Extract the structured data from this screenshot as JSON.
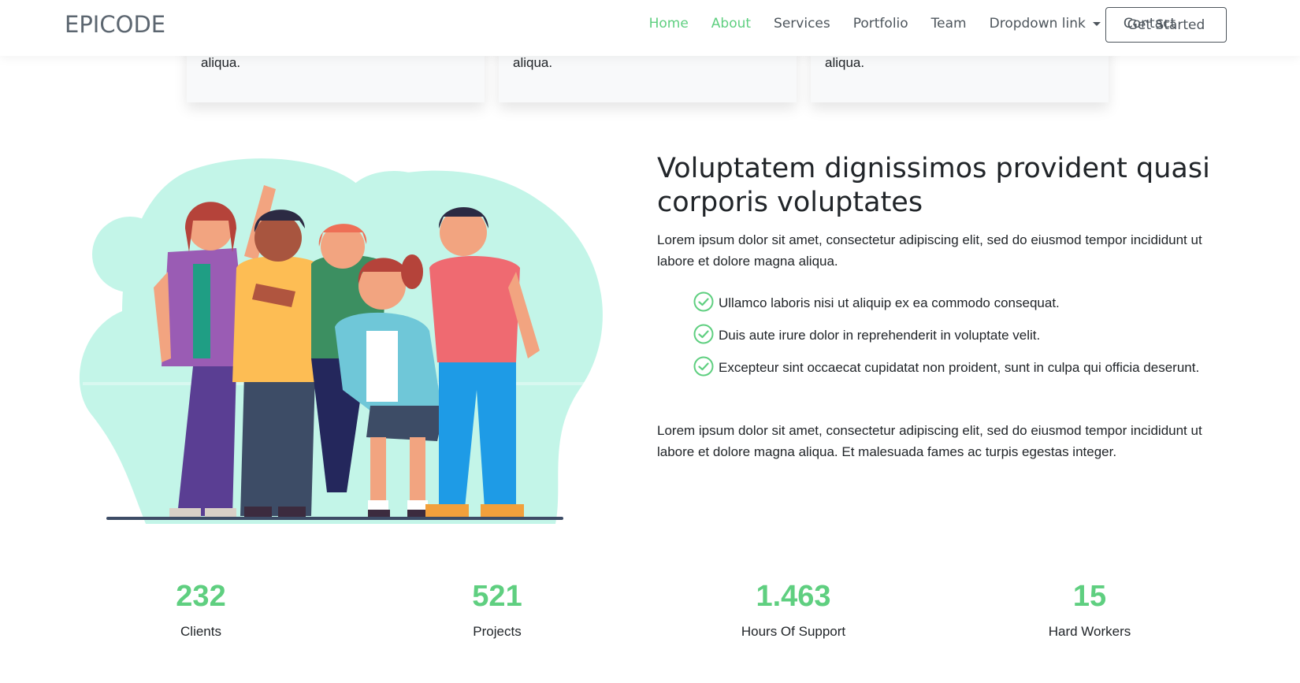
{
  "header": {
    "brand": "EPICODE",
    "nav": [
      {
        "label": "Home",
        "active": true
      },
      {
        "label": "About",
        "active": true
      },
      {
        "label": "Services",
        "active": false
      },
      {
        "label": "Portfolio",
        "active": false
      },
      {
        "label": "Team",
        "active": false
      },
      {
        "label": "Dropdown link",
        "active": false,
        "dropdown": true
      },
      {
        "label": "Contact",
        "active": false
      }
    ],
    "cta": "Get Started"
  },
  "cards": [
    {
      "text": "aliqua."
    },
    {
      "text": "aliqua."
    },
    {
      "text": "aliqua."
    }
  ],
  "about": {
    "heading": "Voluptatem dignissimos provident quasi corporis voluptates",
    "intro": "Lorem ipsum dolor sit amet, consectetur adipiscing elit, sed do eiusmod tempor incididunt ut labore et dolore magna aliqua.",
    "checks": [
      "Ullamco laboris nisi ut aliquip ex ea commodo consequat.",
      "Duis aute irure dolor in reprehenderit in voluptate velit.",
      "Excepteur sint occaecat cupidatat non proident, sunt in culpa qui officia deserunt."
    ],
    "outro": "Lorem ipsum dolor sit amet, consectetur adipiscing elit, sed do eiusmod tempor incididunt ut labore et dolore magna aliqua. Et malesuada fames ac turpis egestas integer."
  },
  "counters": [
    {
      "value": "232",
      "label": "Clients"
    },
    {
      "value": "521",
      "label": "Projects"
    },
    {
      "value": "1.463",
      "label": "Hours Of Support"
    },
    {
      "value": "15",
      "label": "Hard Workers"
    }
  ],
  "colors": {
    "accent": "#5fcf80",
    "text": "#212529",
    "nav": "#4d555c",
    "blob": "#c3f5e8"
  },
  "icons": {
    "check": "check-circle-icon",
    "caret": "chevron-down-icon"
  }
}
